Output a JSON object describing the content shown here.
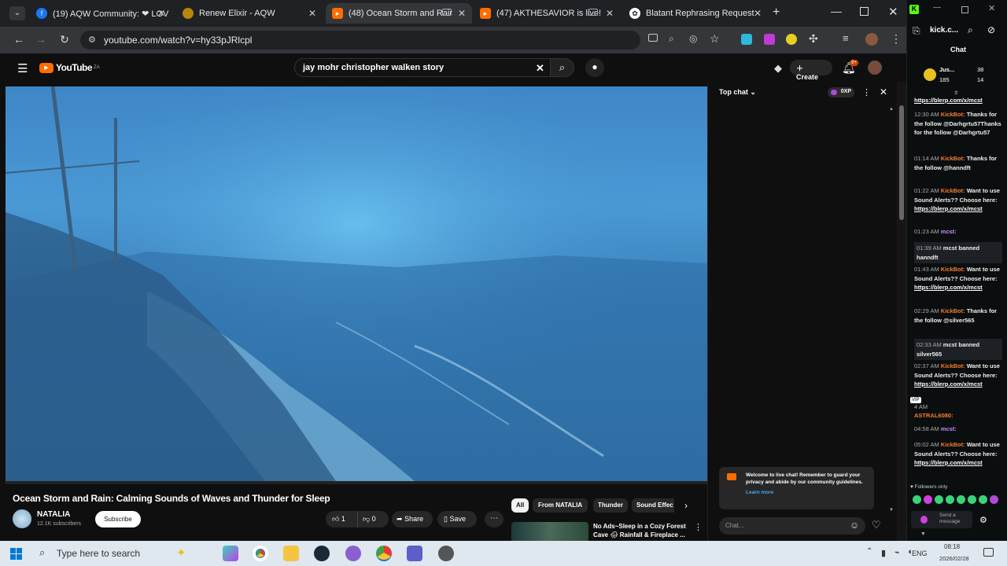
{
  "tabs": [
    {
      "title": "(19) AQW Community: ❤ LOV",
      "icon": "facebook-icon",
      "color": "#1877f2"
    },
    {
      "title": "Renew Elixir - AQW",
      "icon": "aqw-icon",
      "color": "#b8860b"
    },
    {
      "title": "(48) Ocean Storm and Rain",
      "icon": "youtube-icon",
      "color": "#ff6d00"
    },
    {
      "title": "(47) AKTHESAVIOR is live!",
      "icon": "youtube-icon",
      "color": "#ff6d00"
    },
    {
      "title": "Blatant Rephrasing Request",
      "icon": "openai-icon",
      "color": "#ffffff"
    }
  ],
  "address": {
    "url": "youtube.com/watch?v=hy33pJRlcpl"
  },
  "yt": {
    "logo": "YouTube",
    "region": "ZA",
    "search": "jay mohr christopher walken story",
    "create": "Create",
    "notif": "9+"
  },
  "video": {
    "title": "Ocean Storm and Rain: Calming Sounds of Waves and Thunder for Sleep",
    "channel": "NATALIA",
    "subs": "12.1K subscribers",
    "subscribe": "Subscribe",
    "likes": "1",
    "dislikes": "0",
    "share": "Share",
    "save": "Save"
  },
  "chips": [
    "All",
    "From NATALIA",
    "Thunder",
    "Sound Effec"
  ],
  "related": {
    "title": "No Ads~Sleep in a Cozy Forest Cave 🌧 Rainfall & Fireplace ..."
  },
  "ytchat": {
    "header": "Top chat",
    "xp": "0XP",
    "welcome": "Welcome to live chat! Remember to guard your privacy and abide by our community guidelines.",
    "learn": "Learn more",
    "placeholder": "Chat..."
  },
  "kick": {
    "tab": "kick.c...",
    "chat_title": "Chat",
    "user": "Jus...",
    "stats": [
      "38",
      "185",
      "14"
    ],
    "vip": "VIP",
    "followers_only": "Followers only",
    "send": "Send a message",
    "messages": [
      {
        "time": "",
        "user": "",
        "text": "",
        "link": "https://blerp.com/x/mcst",
        "hl": false
      },
      {
        "time": "12:30 AM",
        "user": "KickBot:",
        "text": "Thanks for the follow @Darhgrtu57Thanks for the follow @Darhgrtu57",
        "link": "",
        "hl": false
      },
      {
        "time": "01:14 AM",
        "user": "KickBot:",
        "text": "Thanks for the follow @hanndft",
        "link": "",
        "hl": false
      },
      {
        "time": "01:22 AM",
        "user": "KickBot:",
        "text": "Want to use Sound Alerts?? Choose here:",
        "link": "https://blerp.com/x/mcst",
        "hl": false
      },
      {
        "time": "01:23 AM",
        "user": "mcst:",
        "text": "",
        "link": "",
        "hl": false
      },
      {
        "time": "01:39 AM",
        "user": "",
        "text": "mcst banned hanndft",
        "link": "",
        "hl": true
      },
      {
        "time": "01:43 AM",
        "user": "KickBot:",
        "text": "Want to use Sound Alerts?? Choose here:",
        "link": "https://blerp.com/x/mcst",
        "hl": false
      },
      {
        "time": "02:29 AM",
        "user": "KickBot:",
        "text": "Thanks for the follow @silver565",
        "link": "",
        "hl": false
      },
      {
        "time": "02:33 AM",
        "user": "",
        "text": "mcst banned silver565",
        "link": "",
        "hl": true
      },
      {
        "time": "02:37 AM",
        "user": "KickBot:",
        "text": "Want to use Sound Alerts?? Choose here:",
        "link": "https://blerp.com/x/mcst",
        "hl": false
      },
      {
        "time": "4 AM",
        "user": "",
        "text": "",
        "link": "",
        "hl": false
      },
      {
        "time": "",
        "user": "ASTRAL6080:",
        "text": "",
        "link": "",
        "hl": false
      },
      {
        "time": "04:58 AM",
        "user": "mcst:",
        "text": "",
        "link": "",
        "hl": false
      },
      {
        "time": "05:02 AM",
        "user": "KickBot:",
        "text": "Want to use Sound Alerts?? Choose here:",
        "link": "https://blerp.com/x/mcst",
        "hl": false
      }
    ]
  },
  "taskbar": {
    "search": "Type here to search",
    "lang": "ENG",
    "time": "08:18",
    "date": "2026/02/28"
  }
}
